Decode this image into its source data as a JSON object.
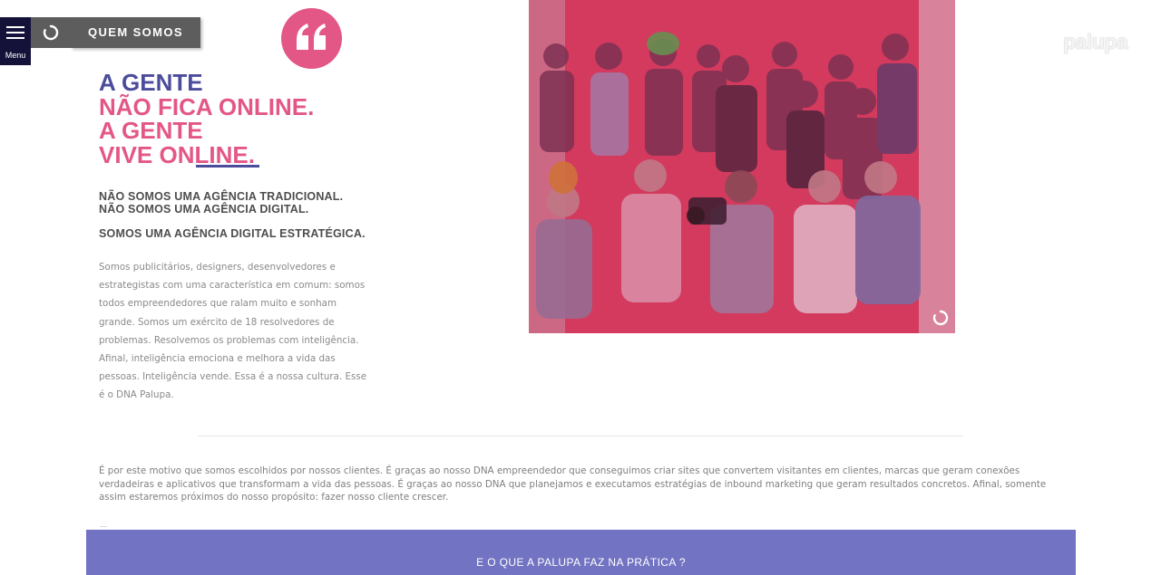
{
  "nav": {
    "menu_label": "Menu",
    "section_label": "QUEM SOMOS"
  },
  "headline": {
    "line1": "A GENTE",
    "line2": "NÃO FICA ONLINE.",
    "line3": "A GENTE",
    "line4": "VIVE ONLINE."
  },
  "subheads": {
    "line1": "NÃO SOMOS UMA AGÊNCIA TRADICIONAL.",
    "line2": "NÃO SOMOS UMA AGÊNCIA DIGITAL.",
    "line3": "SOMOS UMA AGÊNCIA DIGITAL ESTRATÉGICA."
  },
  "about_text": "Somos publicitários, designers, desenvolvedores e estrategistas com uma característica em comum: somos todos empreendedores que ralam muito e sonham grande. Somos um exército de 18 resolvedores de problemas. Resolvemos os problemas com inteligência. Afinal, inteligência emociona e melhora a vida das pessoas. Inteligência vende. Essa é a nossa cultura. Esse é o DNA Palupa.",
  "logo_text": "palupa",
  "closing_text": "É por este motivo que somos escolhidos por nossos clientes. É graças ao nosso DNA empreendedor que conseguimos criar sites que convertem visitantes em clientes, marcas que geram conexões verdadeiras e aplicativos que transformam a vida das pessoas. É graças ao nosso DNA que planejamos e executamos estratégias de inbound marketing que geram resultados concretos. Afinal, somente assim estaremos próximos do nosso propósito: fazer nosso cliente crescer.",
  "cta": {
    "label": "E O QUE A PALUPA FAZ NA PRÁTICA ?"
  },
  "colors": {
    "accent_pink": "#e35787",
    "accent_blue": "#4c4c9c",
    "cta_band": "#7273c2",
    "menu_bg": "#15123a"
  },
  "icons": {
    "menu": "hamburger-icon",
    "refresh": "refresh-icon",
    "quote": "quote-icon",
    "loader": "loader-icon"
  }
}
